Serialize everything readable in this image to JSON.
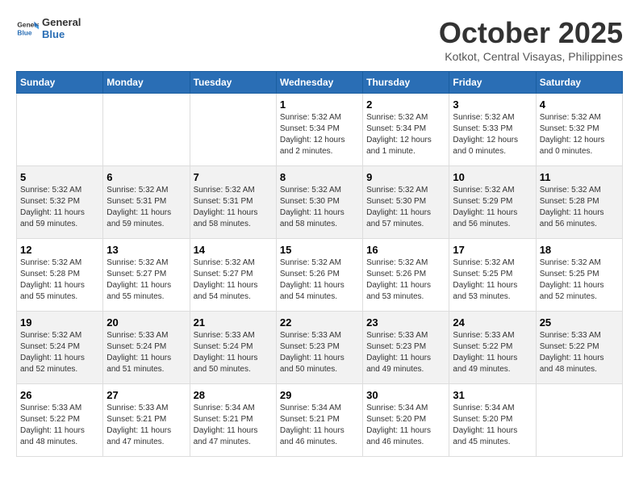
{
  "logo": {
    "general": "General",
    "blue": "Blue"
  },
  "title": "October 2025",
  "location": "Kotkot, Central Visayas, Philippines",
  "weekdays": [
    "Sunday",
    "Monday",
    "Tuesday",
    "Wednesday",
    "Thursday",
    "Friday",
    "Saturday"
  ],
  "weeks": [
    [
      {
        "day": "",
        "sunrise": "",
        "sunset": "",
        "daylight": ""
      },
      {
        "day": "",
        "sunrise": "",
        "sunset": "",
        "daylight": ""
      },
      {
        "day": "",
        "sunrise": "",
        "sunset": "",
        "daylight": ""
      },
      {
        "day": "1",
        "sunrise": "Sunrise: 5:32 AM",
        "sunset": "Sunset: 5:34 PM",
        "daylight": "Daylight: 12 hours and 2 minutes."
      },
      {
        "day": "2",
        "sunrise": "Sunrise: 5:32 AM",
        "sunset": "Sunset: 5:34 PM",
        "daylight": "Daylight: 12 hours and 1 minute."
      },
      {
        "day": "3",
        "sunrise": "Sunrise: 5:32 AM",
        "sunset": "Sunset: 5:33 PM",
        "daylight": "Daylight: 12 hours and 0 minutes."
      },
      {
        "day": "4",
        "sunrise": "Sunrise: 5:32 AM",
        "sunset": "Sunset: 5:32 PM",
        "daylight": "Daylight: 12 hours and 0 minutes."
      }
    ],
    [
      {
        "day": "5",
        "sunrise": "Sunrise: 5:32 AM",
        "sunset": "Sunset: 5:32 PM",
        "daylight": "Daylight: 11 hours and 59 minutes."
      },
      {
        "day": "6",
        "sunrise": "Sunrise: 5:32 AM",
        "sunset": "Sunset: 5:31 PM",
        "daylight": "Daylight: 11 hours and 59 minutes."
      },
      {
        "day": "7",
        "sunrise": "Sunrise: 5:32 AM",
        "sunset": "Sunset: 5:31 PM",
        "daylight": "Daylight: 11 hours and 58 minutes."
      },
      {
        "day": "8",
        "sunrise": "Sunrise: 5:32 AM",
        "sunset": "Sunset: 5:30 PM",
        "daylight": "Daylight: 11 hours and 58 minutes."
      },
      {
        "day": "9",
        "sunrise": "Sunrise: 5:32 AM",
        "sunset": "Sunset: 5:30 PM",
        "daylight": "Daylight: 11 hours and 57 minutes."
      },
      {
        "day": "10",
        "sunrise": "Sunrise: 5:32 AM",
        "sunset": "Sunset: 5:29 PM",
        "daylight": "Daylight: 11 hours and 56 minutes."
      },
      {
        "day": "11",
        "sunrise": "Sunrise: 5:32 AM",
        "sunset": "Sunset: 5:28 PM",
        "daylight": "Daylight: 11 hours and 56 minutes."
      }
    ],
    [
      {
        "day": "12",
        "sunrise": "Sunrise: 5:32 AM",
        "sunset": "Sunset: 5:28 PM",
        "daylight": "Daylight: 11 hours and 55 minutes."
      },
      {
        "day": "13",
        "sunrise": "Sunrise: 5:32 AM",
        "sunset": "Sunset: 5:27 PM",
        "daylight": "Daylight: 11 hours and 55 minutes."
      },
      {
        "day": "14",
        "sunrise": "Sunrise: 5:32 AM",
        "sunset": "Sunset: 5:27 PM",
        "daylight": "Daylight: 11 hours and 54 minutes."
      },
      {
        "day": "15",
        "sunrise": "Sunrise: 5:32 AM",
        "sunset": "Sunset: 5:26 PM",
        "daylight": "Daylight: 11 hours and 54 minutes."
      },
      {
        "day": "16",
        "sunrise": "Sunrise: 5:32 AM",
        "sunset": "Sunset: 5:26 PM",
        "daylight": "Daylight: 11 hours and 53 minutes."
      },
      {
        "day": "17",
        "sunrise": "Sunrise: 5:32 AM",
        "sunset": "Sunset: 5:25 PM",
        "daylight": "Daylight: 11 hours and 53 minutes."
      },
      {
        "day": "18",
        "sunrise": "Sunrise: 5:32 AM",
        "sunset": "Sunset: 5:25 PM",
        "daylight": "Daylight: 11 hours and 52 minutes."
      }
    ],
    [
      {
        "day": "19",
        "sunrise": "Sunrise: 5:32 AM",
        "sunset": "Sunset: 5:24 PM",
        "daylight": "Daylight: 11 hours and 52 minutes."
      },
      {
        "day": "20",
        "sunrise": "Sunrise: 5:33 AM",
        "sunset": "Sunset: 5:24 PM",
        "daylight": "Daylight: 11 hours and 51 minutes."
      },
      {
        "day": "21",
        "sunrise": "Sunrise: 5:33 AM",
        "sunset": "Sunset: 5:24 PM",
        "daylight": "Daylight: 11 hours and 50 minutes."
      },
      {
        "day": "22",
        "sunrise": "Sunrise: 5:33 AM",
        "sunset": "Sunset: 5:23 PM",
        "daylight": "Daylight: 11 hours and 50 minutes."
      },
      {
        "day": "23",
        "sunrise": "Sunrise: 5:33 AM",
        "sunset": "Sunset: 5:23 PM",
        "daylight": "Daylight: 11 hours and 49 minutes."
      },
      {
        "day": "24",
        "sunrise": "Sunrise: 5:33 AM",
        "sunset": "Sunset: 5:22 PM",
        "daylight": "Daylight: 11 hours and 49 minutes."
      },
      {
        "day": "25",
        "sunrise": "Sunrise: 5:33 AM",
        "sunset": "Sunset: 5:22 PM",
        "daylight": "Daylight: 11 hours and 48 minutes."
      }
    ],
    [
      {
        "day": "26",
        "sunrise": "Sunrise: 5:33 AM",
        "sunset": "Sunset: 5:22 PM",
        "daylight": "Daylight: 11 hours and 48 minutes."
      },
      {
        "day": "27",
        "sunrise": "Sunrise: 5:33 AM",
        "sunset": "Sunset: 5:21 PM",
        "daylight": "Daylight: 11 hours and 47 minutes."
      },
      {
        "day": "28",
        "sunrise": "Sunrise: 5:34 AM",
        "sunset": "Sunset: 5:21 PM",
        "daylight": "Daylight: 11 hours and 47 minutes."
      },
      {
        "day": "29",
        "sunrise": "Sunrise: 5:34 AM",
        "sunset": "Sunset: 5:21 PM",
        "daylight": "Daylight: 11 hours and 46 minutes."
      },
      {
        "day": "30",
        "sunrise": "Sunrise: 5:34 AM",
        "sunset": "Sunset: 5:20 PM",
        "daylight": "Daylight: 11 hours and 46 minutes."
      },
      {
        "day": "31",
        "sunrise": "Sunrise: 5:34 AM",
        "sunset": "Sunset: 5:20 PM",
        "daylight": "Daylight: 11 hours and 45 minutes."
      },
      {
        "day": "",
        "sunrise": "",
        "sunset": "",
        "daylight": ""
      }
    ]
  ]
}
